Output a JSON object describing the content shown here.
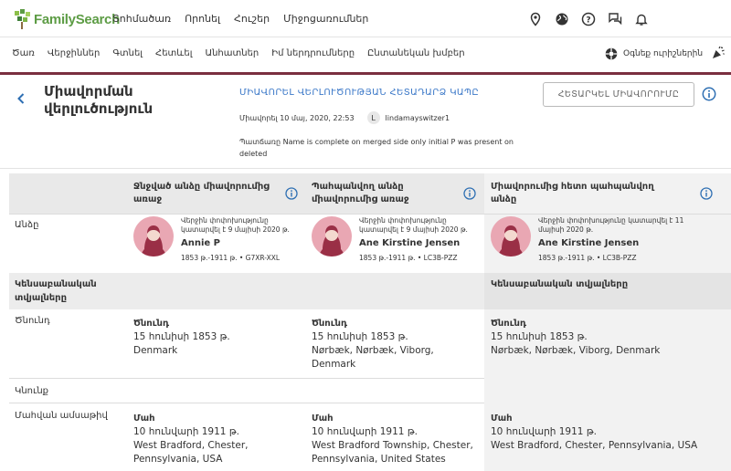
{
  "header": {
    "logo_text": "FamilySearch",
    "nav": [
      "Տոհմածառ",
      "Որոնել",
      "Հուշեր",
      "Միջոցառումներ"
    ],
    "icons": [
      "location-pin-icon",
      "globe-icon",
      "help-icon",
      "chat-icon",
      "bell-icon"
    ]
  },
  "subnav": {
    "items": [
      "Ծառ",
      "Վերջիններ",
      "Գտնել",
      "Հետևել",
      "Անհատներ",
      "Իմ ներդրումները",
      "Ընտանեկան խմբեր"
    ],
    "help_label": "Օգնեք ուրիշներին"
  },
  "page": {
    "title": "Միավորման վերլուծություն",
    "merge_link": "ՄԻԱՎՈՐԵԼ ՎԵՐԼՈՒԾՈՒԹՅԱՆ ՀԵՏԱԴԱՐՁ ԿԱՊԸ",
    "merged_on": "Միավորել 10 մայ, 2020, 22:53",
    "user_initial": "L",
    "username": "lindamayswitzer1",
    "reason": "Պատճառը Name is complete on merged side only initial P was present on deleted",
    "undo_button": "ՀԵՏԱՐԿԵԼ ՄԻԱՎՈՐՈՒՄԸ"
  },
  "columns": [
    {
      "heading": "Ջնջված անձը միավորումից առաջ",
      "note": "Վերջին փոփոխությունը կատարվել է 9 մայիսի 2020 թ.",
      "name": "Annie P",
      "life": "1853 թ.-1911 թ. • G7XR-XXL",
      "birth": {
        "title": "Ծնունդ",
        "date": "15 հունիսի 1853 թ.",
        "place": "Denmark"
      },
      "death": {
        "title": "Մահ",
        "date": "10 հունվարի 1911 թ.",
        "place": "West Bradford, Chester, Pennsylvania, USA"
      }
    },
    {
      "heading": "Պահպանվող անձը միավորումից առաջ",
      "note": "Վերջին փոփոխությունը կատարվել է 9 մայիսի 2020 թ.",
      "name": "Ane Kirstine Jensen",
      "life": "1853 թ.-1911 թ. • LC3B-PZZ",
      "birth": {
        "title": "Ծնունդ",
        "date": "15 հունիսի 1853 թ.",
        "place": "Nørbæk, Nørbæk, Viborg, Denmark"
      },
      "death": {
        "title": "Մահ",
        "date": "10 հունվարի 1911 թ.",
        "place": "West Bradford Township, Chester, Pennsylvania, United States"
      }
    },
    {
      "heading": "Միավորումից հետո պահպանվող անձը",
      "note": "Վերջին փոփոխությունը կատարվել է 11 մայիսի 2020 թ.",
      "name": "Ane Kirstine Jensen",
      "life": "1853 թ.-1911 թ. • LC3B-PZZ",
      "birth": {
        "title": "Ծնունդ",
        "date": "15 հունիսի 1853 թ.",
        "place": "Nørbæk, Nørbæk, Viborg, Denmark"
      },
      "death": {
        "title": "Մահ",
        "date": "10 հունվարի 1911 թ.",
        "place": "West Bradford, Chester, Pennsylvania, USA"
      }
    }
  ],
  "rows": {
    "name_label": "Անձը",
    "vitals_label": "Կենսաբանական տվյալները",
    "vitals_label_right": "Կենսաբանական տվյալները",
    "birth_label": "Ծնունդ",
    "christening_label": "Կնունք",
    "death_label": "Մահվան ամսաթիվ"
  },
  "colors": {
    "accent_link": "#3b78c8",
    "brand_bar": "#7a2f3f",
    "logo_green": "#5d9c45",
    "avatar_pink": "#e9a7b3"
  }
}
